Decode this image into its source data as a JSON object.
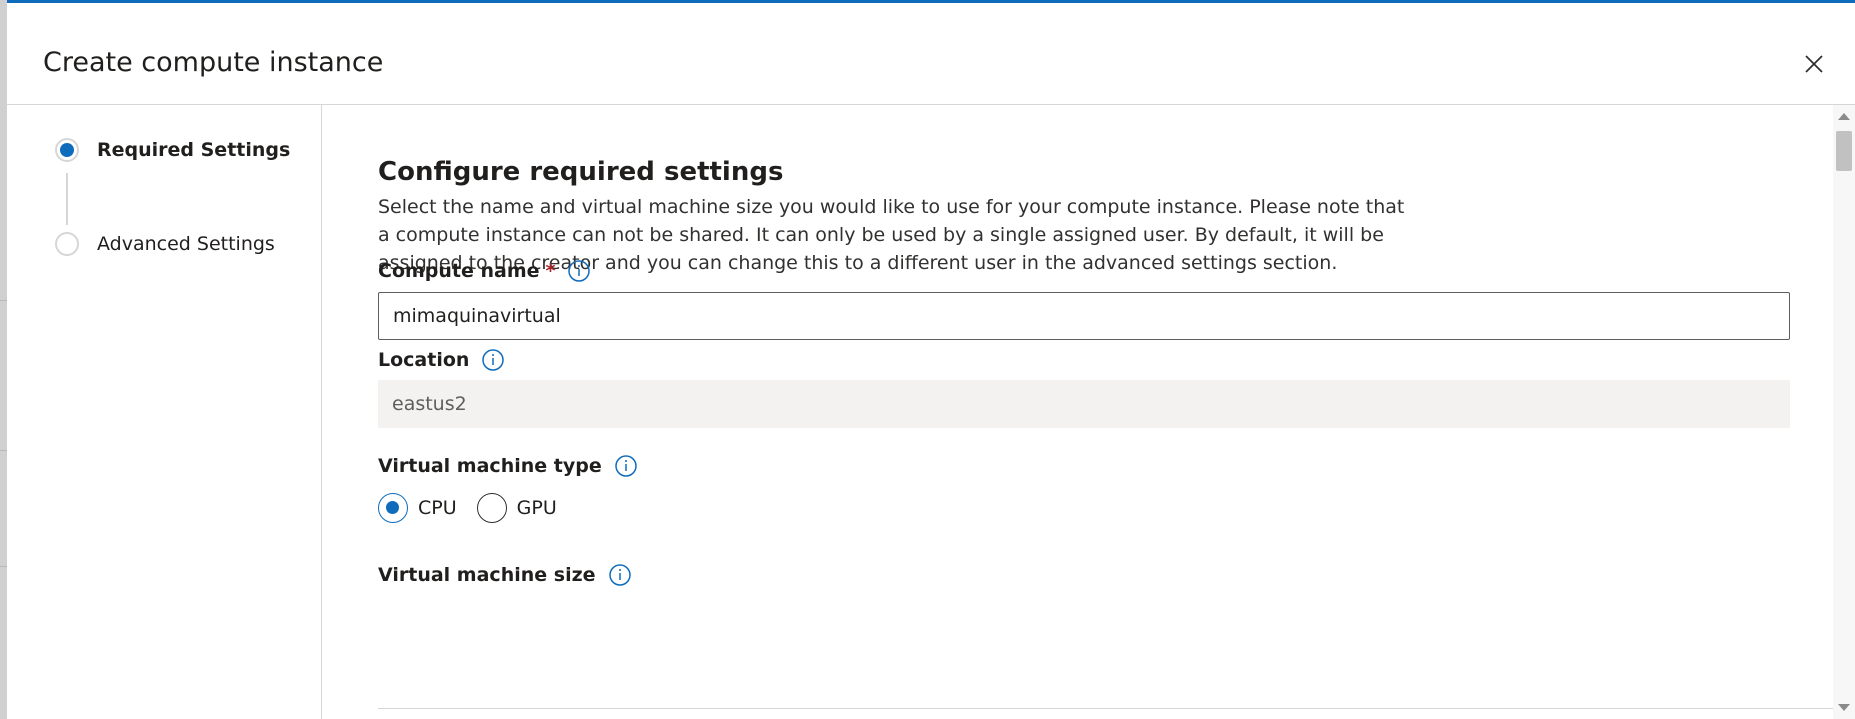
{
  "dialog": {
    "title": "Create compute instance"
  },
  "nav": {
    "steps": [
      {
        "label": "Required Settings",
        "active": true
      },
      {
        "label": "Advanced Settings",
        "active": false
      }
    ]
  },
  "content": {
    "heading": "Configure required settings",
    "description": "Select the name and virtual machine size you would like to use for your compute instance. Please note that a compute instance can not be shared. It can only be used by a single assigned user. By default, it will be assigned to the creator and you can change this to a different user in the advanced settings section.",
    "compute_name": {
      "label": "Compute name",
      "required_mark": "*",
      "value": "mimaquinavirtual"
    },
    "location": {
      "label": "Location",
      "value": "eastus2"
    },
    "vm_type": {
      "label": "Virtual machine type",
      "options": [
        {
          "label": "CPU",
          "checked": true
        },
        {
          "label": "GPU",
          "checked": false
        }
      ]
    },
    "vm_size": {
      "label": "Virtual machine size"
    }
  },
  "colors": {
    "accent": "#0f6cbd",
    "required": "#a4262c"
  },
  "icons": {
    "close": "close-icon",
    "info": "info-icon",
    "eye": "eye-icon"
  }
}
